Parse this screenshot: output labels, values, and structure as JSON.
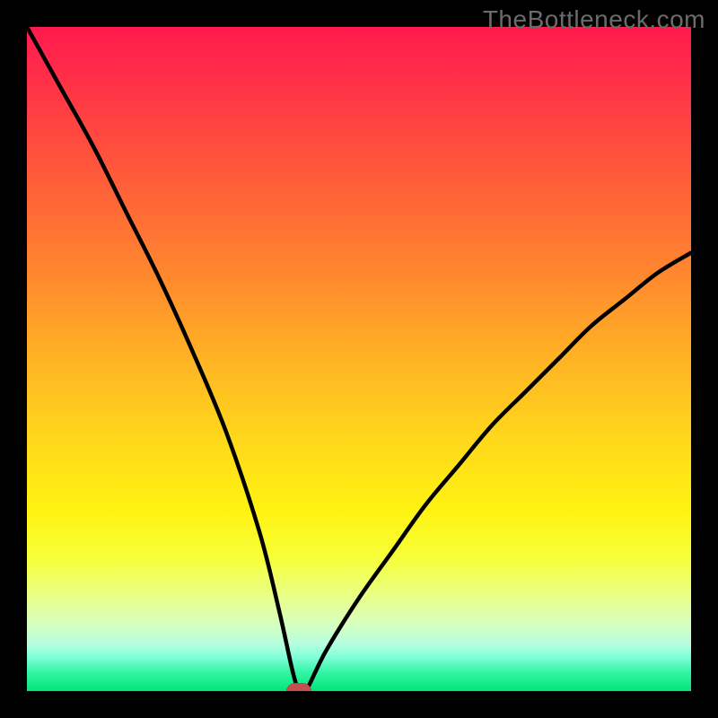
{
  "watermark": "TheBottleneck.com",
  "colors": {
    "frame": "#000000",
    "curve": "#000000",
    "marker": "#c54f4f"
  },
  "chart_data": {
    "type": "line",
    "title": "",
    "xlabel": "",
    "ylabel": "",
    "xlim": [
      0,
      100
    ],
    "ylim": [
      0,
      100
    ],
    "grid": false,
    "legend": false,
    "series": [
      {
        "name": "bottleneck-curve",
        "x": [
          0,
          5,
          10,
          15,
          20,
          25,
          30,
          35,
          38,
          40,
          41,
          42,
          45,
          50,
          55,
          60,
          65,
          70,
          75,
          80,
          85,
          90,
          95,
          100
        ],
        "y": [
          100,
          91,
          82,
          72,
          62,
          51,
          39,
          24,
          12,
          3,
          0,
          0,
          6,
          14,
          21,
          28,
          34,
          40,
          45,
          50,
          55,
          59,
          63,
          66
        ]
      }
    ],
    "annotations": [
      {
        "name": "optimal-marker",
        "x": 41,
        "y": 0
      }
    ],
    "background_gradient": {
      "direction": "vertical",
      "stops": [
        {
          "pos": 0.0,
          "color": "#ff1a4d"
        },
        {
          "pos": 0.5,
          "color": "#ffd81b"
        },
        {
          "pos": 0.8,
          "color": "#f6ff3a"
        },
        {
          "pos": 1.0,
          "color": "#00e676"
        }
      ]
    }
  }
}
